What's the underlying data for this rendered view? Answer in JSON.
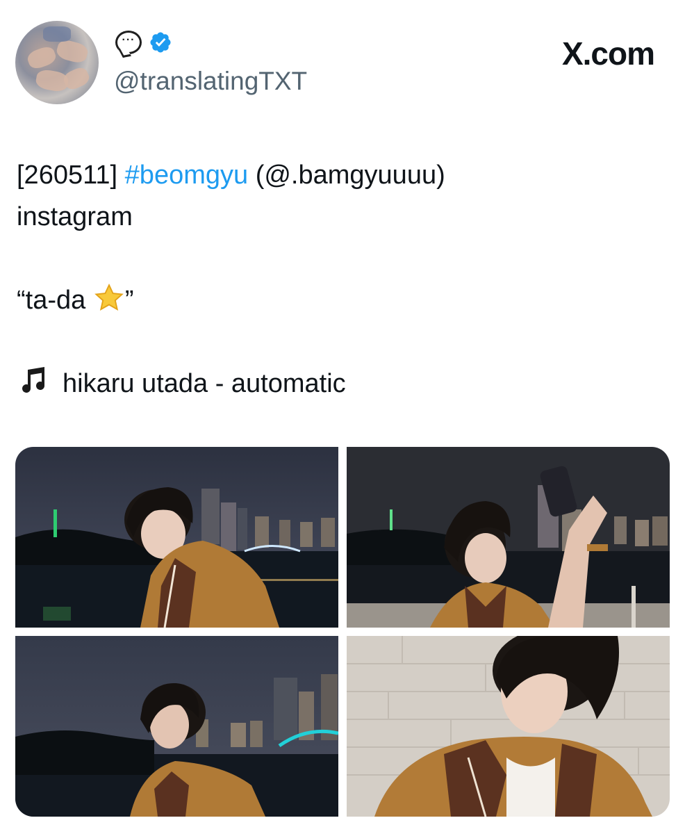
{
  "author": {
    "handle": "@translatingTXT",
    "avatar": "avatar-photo",
    "badges": [
      "speech-bubble-icon",
      "verified-badge-icon"
    ],
    "verified_color": "#1d9bf0"
  },
  "brand": {
    "label": "X.com"
  },
  "tweet": {
    "date": "[260511]",
    "hashtag": "#beomgyu",
    "mention": "(@.bamgyuuuu)",
    "platform": "instagram",
    "quote_open": "“ta-da",
    "quote_close": "”",
    "quote_emoji": "star-icon",
    "song_icon": "music-notes-icon",
    "song": "hikaru utada - automatic"
  },
  "colors": {
    "hashtag": "#1d9bf0",
    "handle": "#536471",
    "text": "#0f1419"
  },
  "media": [
    {
      "name": "photo-1",
      "description": "night-riverside-portrait"
    },
    {
      "name": "photo-2",
      "description": "night-selfie-with-phone"
    },
    {
      "name": "photo-3",
      "description": "night-looking-up"
    },
    {
      "name": "photo-4",
      "description": "wall-closeup-portrait"
    }
  ]
}
